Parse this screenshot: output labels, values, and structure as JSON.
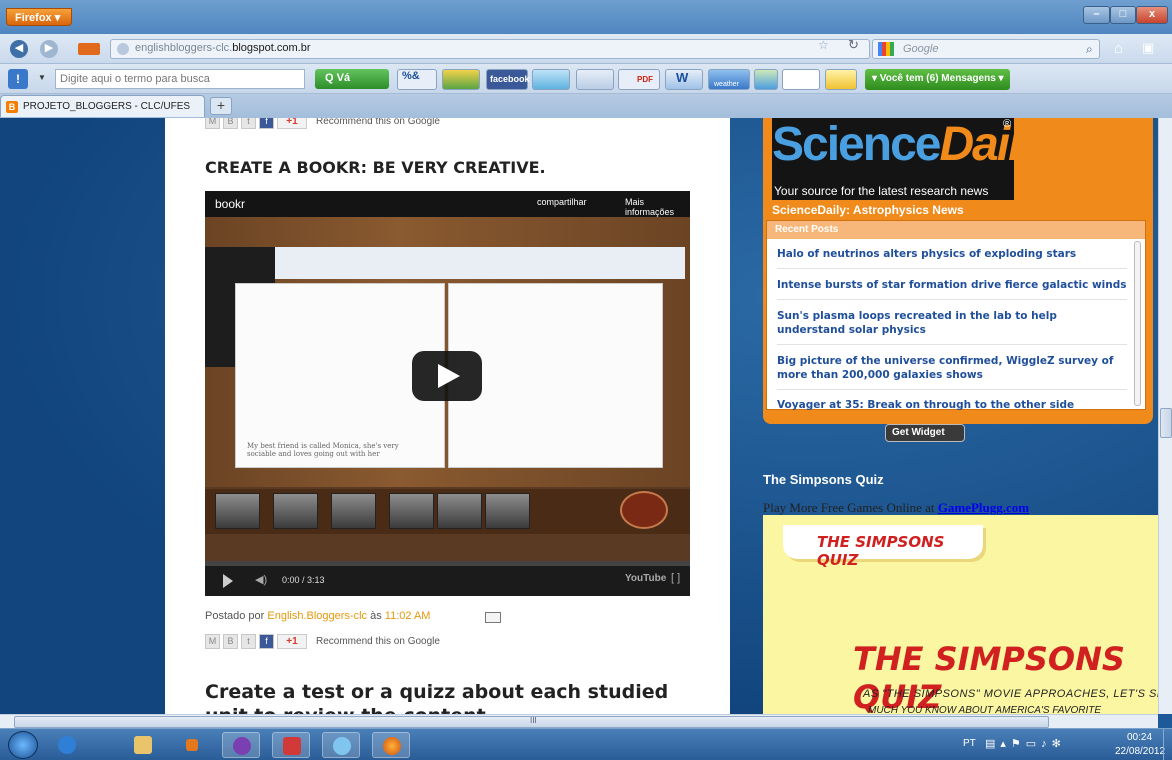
{
  "browser": {
    "menu_button": "Firefox ▾",
    "window_controls": {
      "minimize": "–",
      "maximize": "□",
      "close": "x"
    },
    "url_host_prefix": "englishbloggers-clc.",
    "url_host_main": "blogspot.com.br",
    "search_engine_placeholder": "Google",
    "tab_title": "PROJETO_BLOGGERS - CLC/UFES",
    "new_tab": "+"
  },
  "toolbar": {
    "search_placeholder": "Digite aqui o termo para busca",
    "go_label": "Q   Vá",
    "facebook_label": "facebook",
    "pdf_label": "PDF",
    "weather_label": "weather",
    "messages_label": "▾ Você tem (6) Mensagens ▾"
  },
  "post1": {
    "title": "CREATE A BOOKR: BE VERY CREATIVE.",
    "share_label": "Recommend this on Google",
    "gplus": "+1",
    "video": {
      "brand": "bookr",
      "share": "compartilhar",
      "more_info": "Mais informações",
      "caption": "My best friend is called Monica, she's very sociable and loves going out with her",
      "time": "0:00 / 3:13",
      "youtube": "YouTube"
    },
    "footer_prefix": "Postado por",
    "author": "English.Bloggers-clc",
    "footer_at": "às",
    "time": "11:02 AM"
  },
  "post2": {
    "title": "Create a test or a quizz about each studied unit to review the content"
  },
  "sciencedaily": {
    "logo_a": "Science",
    "logo_b": "Daily",
    "registered": "®",
    "tagline": "Your source for the latest research news",
    "feed_title": "ScienceDaily: Astrophysics News",
    "recent_posts": "Recent Posts",
    "items": [
      "Halo of neutrinos alters physics of exploding stars",
      "Intense bursts of star formation drive fierce galactic winds",
      "Sun's plasma loops recreated in the lab to help understand solar physics",
      "Big picture of the universe confirmed, WiggleZ survey of more than 200,000 galaxies shows",
      "Voyager at 35: Break on through to the other side"
    ],
    "widget_button": "Get Widget"
  },
  "simpsons": {
    "heading": "The Simpsons Quiz",
    "more_games_prefix": "Play More Free Games Online at",
    "more_games_link": "GamePlugg.com",
    "label": "THE SIMPSONS QUIZ",
    "big_title": "THE SIMPSONS QUIZ",
    "blurb": "AS \"THE SIMPSONS\" MOVIE APPROACHES, LET'S SEE HOW",
    "blurb2": "MUCH YOU KNOW ABOUT AMERICA'S FAVORITE"
  },
  "scrollbar": {
    "h_grip": "III"
  },
  "taskbar": {
    "lang": "PT",
    "time": "00:24",
    "date": "22/08/2012"
  },
  "colors": {
    "accent_orange": "#f08a1a",
    "link_blue": "#1f4f9a",
    "author_orange": "#e6980c"
  }
}
